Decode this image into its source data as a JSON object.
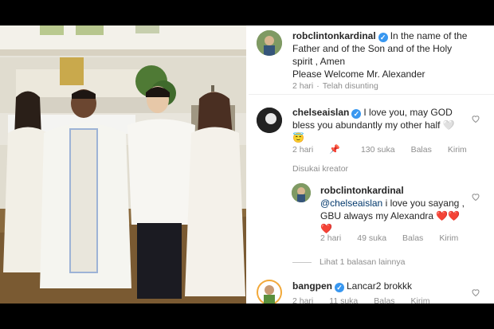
{
  "post": {
    "username": "robclintonkardinal",
    "caption_line1": "In the name of the",
    "caption_line2": "Father and of the Son  and of the Holy",
    "caption_line3": "spirit , Amen",
    "caption_line4": "Please Welcome Mr. Alexander",
    "time": "2 hari",
    "separator": "·",
    "edited": "Telah disunting"
  },
  "comments": [
    {
      "username": "chelseaislan",
      "line1": "I love you, may GOD",
      "line2": "bless you abundantly my other half",
      "emoji1": "🤍",
      "emoji2": "😇",
      "time": "2 hari",
      "likes": "130 suka",
      "reply": "Balas",
      "send": "Kirim",
      "liked_by_creator": "Disukai kreator"
    },
    {
      "username": "robclintonkardinal",
      "mention": "@chelseaislan",
      "line1": "i love you sayang ,",
      "line2": "GBU always my Alexandra",
      "hearts": "❤️❤️",
      "heart3": "❤️",
      "time": "2 hari",
      "likes": "49 suka",
      "reply": "Balas",
      "send": "Kirim"
    },
    {
      "username": "bangpen",
      "text": "Lancar2 brokkk",
      "time": "2 hari",
      "likes": "11 suka",
      "reply": "Balas",
      "send": "Kirim"
    }
  ],
  "view_more_replies": "Lihat 1 balasan lainnya",
  "colors": {
    "verified": "#3897f0",
    "text": "#262626",
    "muted": "#8e8e8e",
    "link": "#00376b",
    "like": "#ed4956"
  }
}
